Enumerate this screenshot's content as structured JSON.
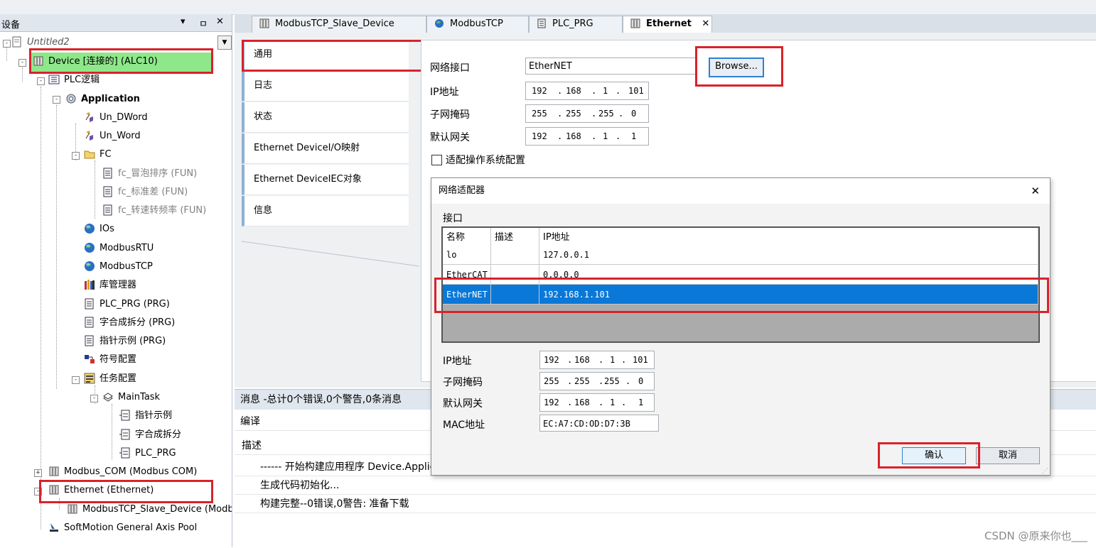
{
  "left_panel": {
    "title": "设备",
    "controls": [
      "▾",
      "ㅁ",
      "✕"
    ],
    "tree": [
      {
        "label": "Untitled2",
        "style": "italic"
      },
      {
        "label": "Device [连接的] (ALC10)"
      },
      {
        "label": "PLC逻辑"
      },
      {
        "label": "Application"
      },
      {
        "label": "Un_DWord"
      },
      {
        "label": "Un_Word"
      },
      {
        "label": "FC"
      },
      {
        "label": "fc_冒泡排序 (FUN)"
      },
      {
        "label": "fc_标准差 (FUN)"
      },
      {
        "label": "fc_转速转频率 (FUN)"
      },
      {
        "label": "IOs"
      },
      {
        "label": "ModbusRTU"
      },
      {
        "label": "ModbusTCP"
      },
      {
        "label": "库管理器"
      },
      {
        "label": "PLC_PRG (PRG)"
      },
      {
        "label": "字合成拆分 (PRG)"
      },
      {
        "label": "指针示例 (PRG)"
      },
      {
        "label": "符号配置"
      },
      {
        "label": "任务配置"
      },
      {
        "label": "MainTask"
      },
      {
        "label": "指针示例"
      },
      {
        "label": "字合成拆分"
      },
      {
        "label": "PLC_PRG"
      },
      {
        "label": "Modbus_COM (Modbus COM)"
      },
      {
        "label": "Ethernet (Ethernet)"
      },
      {
        "label": "ModbusTCP_Slave_Device (Modbus"
      },
      {
        "label": "SoftMotion General Axis Pool"
      }
    ]
  },
  "tabs": [
    {
      "label": "ModbusTCP_Slave_Device",
      "active": false
    },
    {
      "label": "ModbusTCP",
      "active": false
    },
    {
      "label": "PLC_PRG",
      "active": false
    },
    {
      "label": "Ethernet",
      "active": true,
      "close": "✕"
    }
  ],
  "nav": [
    "通用",
    "日志",
    "状态",
    "Ethernet DeviceI/O映射",
    "Ethernet DeviceIEC对象",
    "信息"
  ],
  "general": {
    "interface_label": "网络接口",
    "interface_value": "EtherNET",
    "browse_label": "Browse...",
    "ip_label": "IP地址",
    "ip": [
      "192",
      "168",
      "1",
      "101"
    ],
    "subnet_label": "子网掩码",
    "subnet": [
      "255",
      "255",
      "255",
      "0"
    ],
    "gateway_label": "默认网关",
    "gateway": [
      "192",
      "168",
      "1",
      "1"
    ],
    "adapt_os_label": "适配操作系统配置"
  },
  "messages": {
    "header": "消息 -总计0个错误,0个警告,0条消息",
    "compile_label": "编译",
    "desc_col": "描述",
    "rows": [
      "------ 开始构建应用程序 Device.Applica",
      "生成代码初始化...",
      "构建完整--0错误,0警告: 准备下载"
    ]
  },
  "dialog": {
    "title": "网络适配器",
    "close": "✕",
    "group_label": "接口",
    "columns": [
      "名称",
      "描述",
      "IP地址"
    ],
    "rows": [
      {
        "name": "lo",
        "desc": "",
        "ip": "127.0.0.1",
        "selected": false
      },
      {
        "name": "EtherCAT",
        "desc": "",
        "ip": "0.0.0.0",
        "selected": false
      },
      {
        "name": "EtherNET",
        "desc": "",
        "ip": "192.168.1.101",
        "selected": true
      }
    ],
    "ip_label": "IP地址",
    "ip": [
      "192",
      "168",
      "1",
      "101"
    ],
    "subnet_label": "子网掩码",
    "subnet": [
      "255",
      "255",
      "255",
      "0"
    ],
    "gateway_label": "默认网关",
    "gateway": [
      "192",
      "168",
      "1",
      "1"
    ],
    "mac_label": "MAC地址",
    "mac": "EC:A7:CD:OD:D7:3B",
    "ok_label": "确认",
    "cancel_label": "取消"
  },
  "watermark": "CSDN @原来你也___",
  "colors": {
    "highlight_red": "#d9222a",
    "selection_blue": "#0a78d7",
    "device_green": "#8ee88a"
  }
}
